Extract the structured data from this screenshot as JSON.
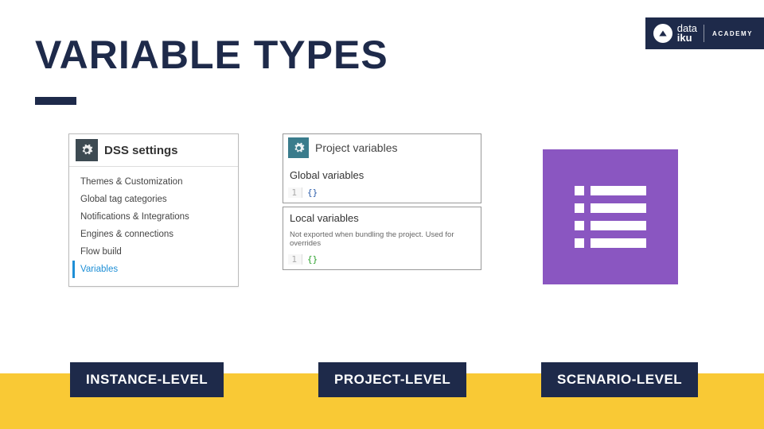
{
  "brand": {
    "line1": "data",
    "line2": "iku",
    "academy": "ACADEMY"
  },
  "title": "VARIABLE TYPES",
  "instance": {
    "header": "DSS settings",
    "items": [
      "Themes & Customization",
      "Global tag categories",
      "Notifications & Integrations",
      "Engines & connections",
      "Flow build",
      "Variables"
    ]
  },
  "project": {
    "header": "Project variables",
    "global_heading": "Global variables",
    "code_line_num": "1",
    "code_braces": "{}",
    "local_heading": "Local variables",
    "local_hint": "Not exported when bundling the project. Used for overrides"
  },
  "labels": {
    "instance": "INSTANCE-LEVEL",
    "project": "PROJECT-LEVEL",
    "scenario": "SCENARIO-LEVEL"
  }
}
